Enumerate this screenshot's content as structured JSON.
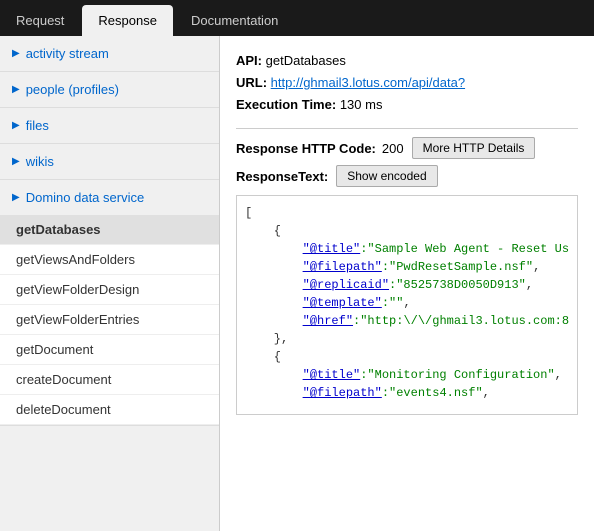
{
  "tabs": [
    {
      "id": "request",
      "label": "Request",
      "active": false
    },
    {
      "id": "response",
      "label": "Response",
      "active": true
    },
    {
      "id": "documentation",
      "label": "Documentation",
      "active": false
    }
  ],
  "sidebar": {
    "sections": [
      {
        "id": "activity-stream",
        "label": "activity stream",
        "expanded": false,
        "items": []
      },
      {
        "id": "people-profiles",
        "label": "people (profiles)",
        "expanded": false,
        "items": []
      },
      {
        "id": "files",
        "label": "files",
        "expanded": false,
        "items": []
      },
      {
        "id": "wikis",
        "label": "wikis",
        "expanded": false,
        "items": []
      },
      {
        "id": "domino-data-service",
        "label": "Domino data service",
        "expanded": true,
        "items": [
          {
            "id": "getDatabases",
            "label": "getDatabases",
            "active": true
          },
          {
            "id": "getViewsAndFolders",
            "label": "getViewsAndFolders",
            "active": false
          },
          {
            "id": "getViewFolderDesign",
            "label": "getViewFolderDesign",
            "active": false
          },
          {
            "id": "getViewFolderEntries",
            "label": "getViewFolderEntries",
            "active": false
          },
          {
            "id": "getDocument",
            "label": "getDocument",
            "active": false
          },
          {
            "id": "createDocument",
            "label": "createDocument",
            "active": false
          },
          {
            "id": "deleteDocument",
            "label": "deleteDocument",
            "active": false
          }
        ]
      }
    ]
  },
  "content": {
    "api_label": "API:",
    "api_name": "getDatabases",
    "url_label": "URL:",
    "url_value": "http://ghmail3.lotus.com/api/data?",
    "exec_time_label": "Execution Time:",
    "exec_time_value": "130 ms",
    "response_http_label": "Response HTTP Code:",
    "response_http_code": "200",
    "more_http_btn": "More HTTP Details",
    "response_text_label": "ResponseText:",
    "show_encoded_btn": "Show encoded",
    "code_content": "[\n    {\n        \"@title\":\"Sample Web Agent - Reset Us\n        \"@filepath\":\"PwdResetSample.nsf\",\n        \"@replicaid\":\"8525738D0050D913\",\n        \"@template\":\"\",\n        \"@href\":\"http:\\/\\/ghmail3.lotus.com:8\n    },\n    {\n        \"@title\":\"Monitoring Configuration\",\n        \"@filepath\":\"events4.nsf\","
  }
}
